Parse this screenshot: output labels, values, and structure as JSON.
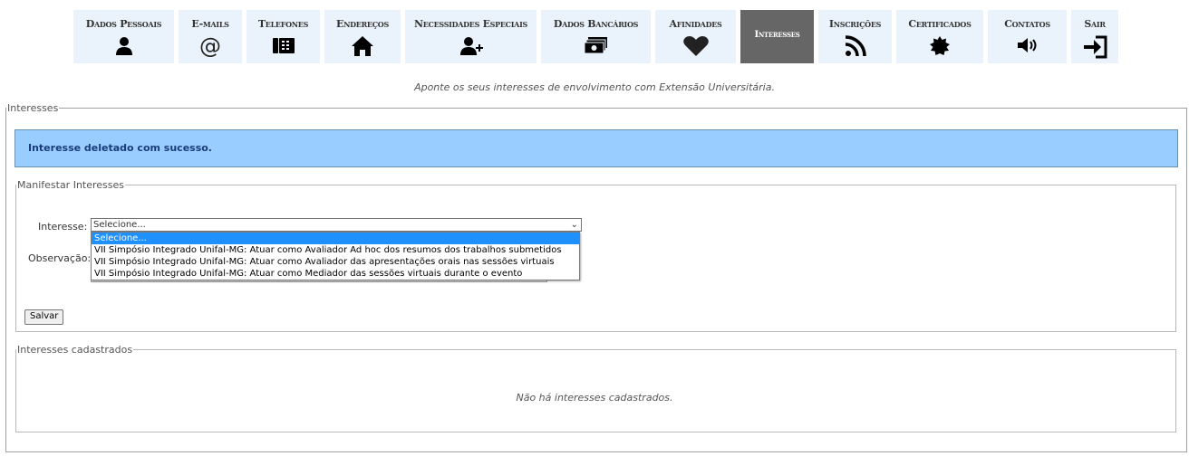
{
  "nav": {
    "tabs": [
      {
        "label": "Dados Pessoais",
        "icon": "user-icon"
      },
      {
        "label": "E-mails",
        "icon": "at-icon"
      },
      {
        "label": "Telefones",
        "icon": "phone-icon"
      },
      {
        "label": "Endereços",
        "icon": "home-icon"
      },
      {
        "label": "Necessidades Especiais",
        "icon": "user-plus-icon"
      },
      {
        "label": "Dados Bancários",
        "icon": "money-icon"
      },
      {
        "label": "Afinidades",
        "icon": "heart-icon"
      },
      {
        "label": "Interesses",
        "icon": "",
        "active": true
      },
      {
        "label": "Inscrições",
        "icon": "rss-icon"
      },
      {
        "label": "Certificados",
        "icon": "certificate-icon"
      },
      {
        "label": "Contatos",
        "icon": "volume-icon"
      },
      {
        "label": "Sair",
        "icon": "sign-in-icon"
      }
    ],
    "active_color": "#666666",
    "tab_color": "#eaf3fb"
  },
  "hint": "Aponte os seus interesses de envolvimento com Extensão Universitária.",
  "main_legend": "Interesses",
  "alert": {
    "text": "Interesse deletado com sucesso.",
    "bg": "#99ccff"
  },
  "form": {
    "legend": "Manifestar Interesses",
    "interesse_label": "Interesse:",
    "observacao_label": "Observação:",
    "select_value": "Selecione...",
    "options": [
      "Selecione...",
      "VII Simpósio Integrado Unifal-MG: Atuar como Avaliador Ad hoc dos resumos dos trabalhos submetidos",
      "VII Simpósio Integrado Unifal-MG: Atuar como Avaliador das apresentações orais nas sessões virtuais",
      "VII Simpósio Integrado Unifal-MG: Atuar como Mediador das sessões virtuais durante o evento"
    ],
    "save_label": "Salvar"
  },
  "registered": {
    "legend": "Interesses cadastrados",
    "empty_text": "Não há interesses cadastrados."
  }
}
